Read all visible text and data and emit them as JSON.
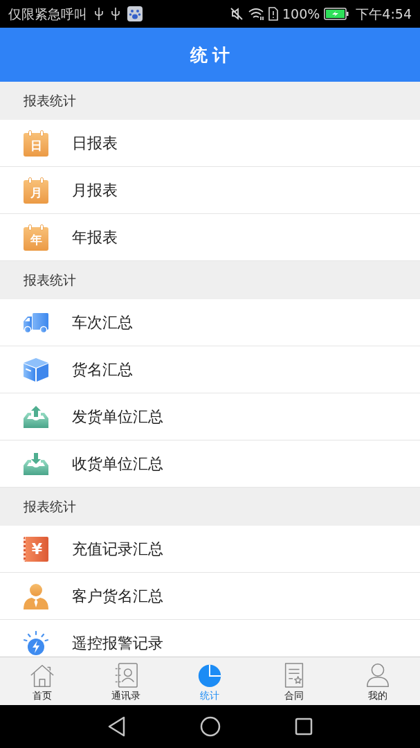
{
  "status_bar": {
    "carrier_text": "仅限紧急呼叫",
    "battery_percent": "100%",
    "time": "下午4:54"
  },
  "title_bar": {
    "title": "统计"
  },
  "sections": [
    {
      "title": "报表统计",
      "items": [
        {
          "kind": "calendar",
          "icon_text": "日",
          "label": "日报表"
        },
        {
          "kind": "calendar",
          "icon_text": "月",
          "label": "月报表"
        },
        {
          "kind": "calendar",
          "icon_text": "年",
          "label": "年报表"
        }
      ]
    },
    {
      "title": "报表统计",
      "items": [
        {
          "kind": "truck",
          "label": "车次汇总"
        },
        {
          "kind": "package",
          "label": "货名汇总"
        },
        {
          "kind": "tray-out",
          "label": "发货单位汇总"
        },
        {
          "kind": "tray-in",
          "label": "收货单位汇总"
        }
      ]
    },
    {
      "title": "报表统计",
      "items": [
        {
          "kind": "yuan-note",
          "icon_text": "¥",
          "label": "充值记录汇总"
        },
        {
          "kind": "person",
          "label": "客户货名汇总"
        },
        {
          "kind": "alarm",
          "label": "遥控报警记录"
        }
      ]
    }
  ],
  "tab_bar": [
    {
      "kind": "home",
      "label": "首页",
      "selected": false
    },
    {
      "kind": "contacts",
      "label": "通讯录",
      "selected": false
    },
    {
      "kind": "chart",
      "label": "统计",
      "selected": true
    },
    {
      "kind": "contract",
      "label": "合同",
      "selected": false
    },
    {
      "kind": "profile",
      "label": "我的",
      "selected": false
    }
  ]
}
